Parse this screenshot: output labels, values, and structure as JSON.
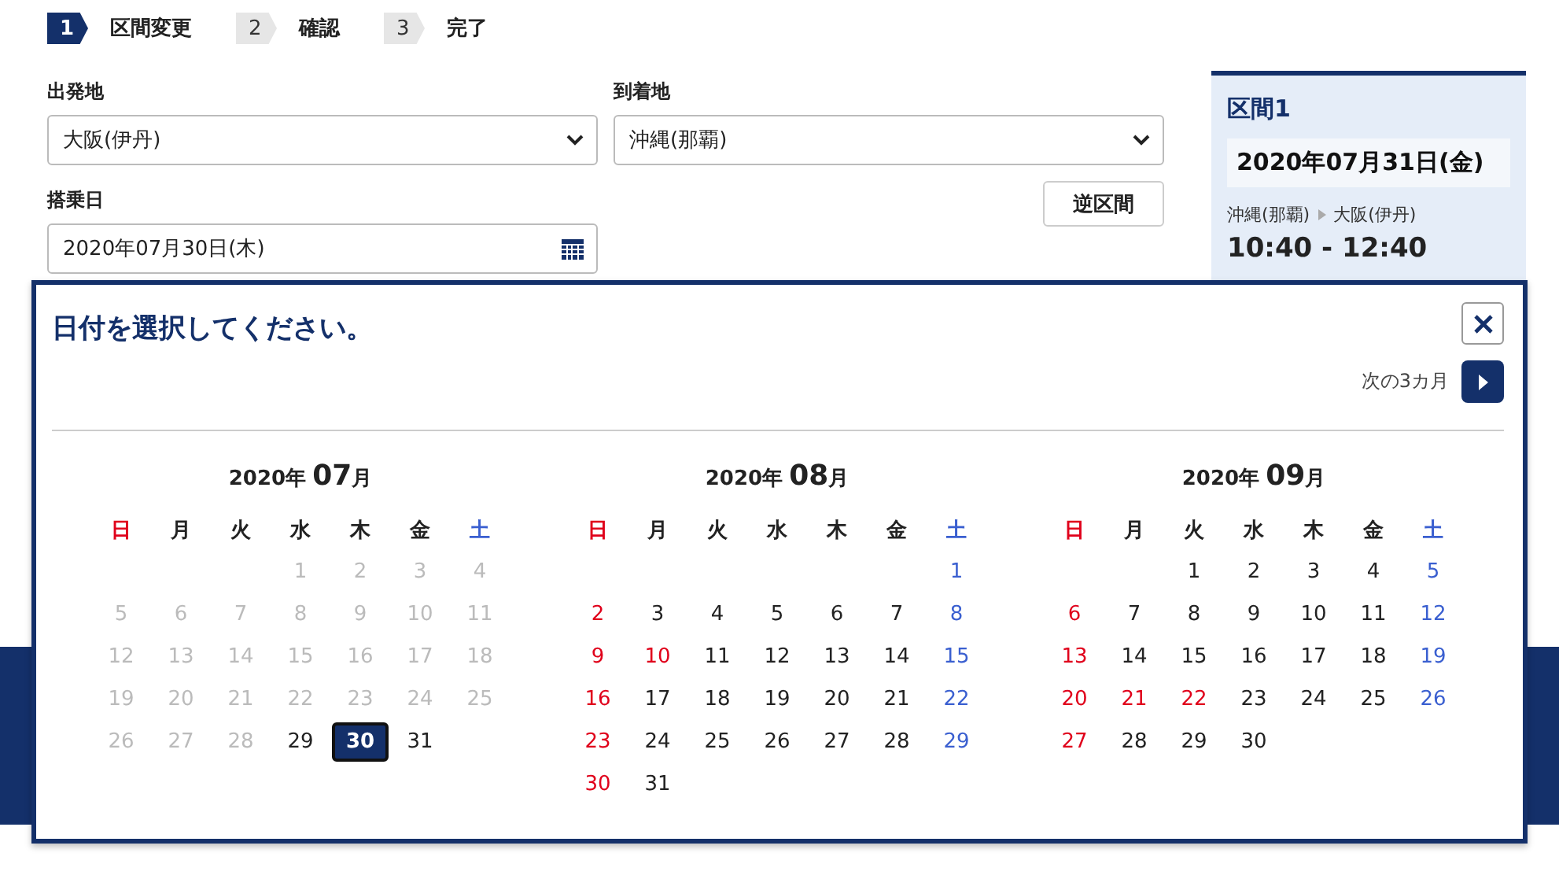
{
  "steps": [
    {
      "number": "1",
      "label": "区間変更",
      "selected": true
    },
    {
      "number": "2",
      "label": "確認",
      "selected": false
    },
    {
      "number": "3",
      "label": "完了",
      "selected": false
    }
  ],
  "form": {
    "departure": {
      "label": "出発地",
      "value": "大阪(伊丹)"
    },
    "arrival": {
      "label": "到着地",
      "value": "沖縄(那覇)"
    },
    "reverse_button": "逆区間",
    "date": {
      "label": "搭乗日",
      "value": "2020年07月30日(木)"
    }
  },
  "segment": {
    "title": "区間1",
    "date": "2020年07月31日(金)",
    "from": "沖縄(那覇)",
    "to": "大阪(伊丹)",
    "time": "10:40 - 12:40"
  },
  "datepicker": {
    "title": "日付を選択してください。",
    "next_label": "次の3カ月",
    "months": [
      {
        "year": "2020年",
        "month": "07",
        "unit": "月",
        "weekdays": [
          {
            "label": "日",
            "kind": "sunday"
          },
          {
            "label": "月",
            "kind": "weekday"
          },
          {
            "label": "火",
            "kind": "weekday"
          },
          {
            "label": "水",
            "kind": "weekday"
          },
          {
            "label": "木",
            "kind": "weekday"
          },
          {
            "label": "金",
            "kind": "weekday"
          },
          {
            "label": "土",
            "kind": "saturday"
          }
        ],
        "weeks": [
          [
            {
              "day": "1",
              "kind": "past",
              "selected": false
            },
            {
              "day": "2",
              "kind": "past",
              "selected": false
            },
            {
              "day": "3",
              "kind": "past",
              "selected": false
            },
            {
              "day": "4",
              "kind": "past",
              "selected": false
            }
          ],
          [
            {
              "day": "5",
              "kind": "past",
              "selected": false
            },
            {
              "day": "6",
              "kind": "past",
              "selected": false
            },
            {
              "day": "7",
              "kind": "past",
              "selected": false
            },
            {
              "day": "8",
              "kind": "past",
              "selected": false
            },
            {
              "day": "9",
              "kind": "past",
              "selected": false
            },
            {
              "day": "10",
              "kind": "past",
              "selected": false
            },
            {
              "day": "11",
              "kind": "past",
              "selected": false
            }
          ],
          [
            {
              "day": "12",
              "kind": "past",
              "selected": false
            },
            {
              "day": "13",
              "kind": "past",
              "selected": false
            },
            {
              "day": "14",
              "kind": "past",
              "selected": false
            },
            {
              "day": "15",
              "kind": "past",
              "selected": false
            },
            {
              "day": "16",
              "kind": "past",
              "selected": false
            },
            {
              "day": "17",
              "kind": "past",
              "selected": false
            },
            {
              "day": "18",
              "kind": "past",
              "selected": false
            }
          ],
          [
            {
              "day": "19",
              "kind": "past",
              "selected": false
            },
            {
              "day": "20",
              "kind": "past",
              "selected": false
            },
            {
              "day": "21",
              "kind": "past",
              "selected": false
            },
            {
              "day": "22",
              "kind": "past",
              "selected": false
            },
            {
              "day": "23",
              "kind": "past",
              "selected": false
            },
            {
              "day": "24",
              "kind": "past",
              "selected": false
            },
            {
              "day": "25",
              "kind": "past",
              "selected": false
            }
          ],
          [
            {
              "day": "26",
              "kind": "past",
              "selected": false
            },
            {
              "day": "27",
              "kind": "past",
              "selected": false
            },
            {
              "day": "28",
              "kind": "past",
              "selected": false
            },
            {
              "day": "29",
              "kind": "normal",
              "selected": false
            },
            {
              "day": "30",
              "kind": "normal",
              "selected": true
            },
            {
              "day": "31",
              "kind": "normal",
              "selected": false
            }
          ]
        ]
      },
      {
        "year": "2020年",
        "month": "08",
        "unit": "月",
        "weekdays": [
          {
            "label": "日",
            "kind": "sunday"
          },
          {
            "label": "月",
            "kind": "weekday"
          },
          {
            "label": "火",
            "kind": "weekday"
          },
          {
            "label": "水",
            "kind": "weekday"
          },
          {
            "label": "木",
            "kind": "weekday"
          },
          {
            "label": "金",
            "kind": "weekday"
          },
          {
            "label": "土",
            "kind": "saturday"
          }
        ],
        "weeks": [
          [
            {
              "day": "1",
              "kind": "saturday",
              "selected": false
            }
          ],
          [
            {
              "day": "2",
              "kind": "holiday",
              "selected": false
            },
            {
              "day": "3",
              "kind": "normal",
              "selected": false
            },
            {
              "day": "4",
              "kind": "normal",
              "selected": false
            },
            {
              "day": "5",
              "kind": "normal",
              "selected": false
            },
            {
              "day": "6",
              "kind": "normal",
              "selected": false
            },
            {
              "day": "7",
              "kind": "normal",
              "selected": false
            },
            {
              "day": "8",
              "kind": "saturday",
              "selected": false
            }
          ],
          [
            {
              "day": "9",
              "kind": "holiday",
              "selected": false
            },
            {
              "day": "10",
              "kind": "holiday",
              "selected": false
            },
            {
              "day": "11",
              "kind": "normal",
              "selected": false
            },
            {
              "day": "12",
              "kind": "normal",
              "selected": false
            },
            {
              "day": "13",
              "kind": "normal",
              "selected": false
            },
            {
              "day": "14",
              "kind": "normal",
              "selected": false
            },
            {
              "day": "15",
              "kind": "saturday",
              "selected": false
            }
          ],
          [
            {
              "day": "16",
              "kind": "holiday",
              "selected": false
            },
            {
              "day": "17",
              "kind": "normal",
              "selected": false
            },
            {
              "day": "18",
              "kind": "normal",
              "selected": false
            },
            {
              "day": "19",
              "kind": "normal",
              "selected": false
            },
            {
              "day": "20",
              "kind": "normal",
              "selected": false
            },
            {
              "day": "21",
              "kind": "normal",
              "selected": false
            },
            {
              "day": "22",
              "kind": "saturday",
              "selected": false
            }
          ],
          [
            {
              "day": "23",
              "kind": "holiday",
              "selected": false
            },
            {
              "day": "24",
              "kind": "normal",
              "selected": false
            },
            {
              "day": "25",
              "kind": "normal",
              "selected": false
            },
            {
              "day": "26",
              "kind": "normal",
              "selected": false
            },
            {
              "day": "27",
              "kind": "normal",
              "selected": false
            },
            {
              "day": "28",
              "kind": "normal",
              "selected": false
            },
            {
              "day": "29",
              "kind": "saturday",
              "selected": false
            }
          ],
          [
            {
              "day": "30",
              "kind": "holiday",
              "selected": false
            },
            {
              "day": "31",
              "kind": "normal",
              "selected": false
            }
          ]
        ]
      },
      {
        "year": "2020年",
        "month": "09",
        "unit": "月",
        "weekdays": [
          {
            "label": "日",
            "kind": "sunday"
          },
          {
            "label": "月",
            "kind": "weekday"
          },
          {
            "label": "火",
            "kind": "weekday"
          },
          {
            "label": "水",
            "kind": "weekday"
          },
          {
            "label": "木",
            "kind": "weekday"
          },
          {
            "label": "金",
            "kind": "weekday"
          },
          {
            "label": "土",
            "kind": "saturday"
          }
        ],
        "weeks": [
          [
            {
              "day": "1",
              "kind": "normal",
              "selected": false
            },
            {
              "day": "2",
              "kind": "normal",
              "selected": false
            },
            {
              "day": "3",
              "kind": "normal",
              "selected": false
            },
            {
              "day": "4",
              "kind": "normal",
              "selected": false
            },
            {
              "day": "5",
              "kind": "saturday",
              "selected": false
            }
          ],
          [
            {
              "day": "6",
              "kind": "holiday",
              "selected": false
            },
            {
              "day": "7",
              "kind": "normal",
              "selected": false
            },
            {
              "day": "8",
              "kind": "normal",
              "selected": false
            },
            {
              "day": "9",
              "kind": "normal",
              "selected": false
            },
            {
              "day": "10",
              "kind": "normal",
              "selected": false
            },
            {
              "day": "11",
              "kind": "normal",
              "selected": false
            },
            {
              "day": "12",
              "kind": "saturday",
              "selected": false
            }
          ],
          [
            {
              "day": "13",
              "kind": "holiday",
              "selected": false
            },
            {
              "day": "14",
              "kind": "normal",
              "selected": false
            },
            {
              "day": "15",
              "kind": "normal",
              "selected": false
            },
            {
              "day": "16",
              "kind": "normal",
              "selected": false
            },
            {
              "day": "17",
              "kind": "normal",
              "selected": false
            },
            {
              "day": "18",
              "kind": "normal",
              "selected": false
            },
            {
              "day": "19",
              "kind": "saturday",
              "selected": false
            }
          ],
          [
            {
              "day": "20",
              "kind": "holiday",
              "selected": false
            },
            {
              "day": "21",
              "kind": "holiday",
              "selected": false
            },
            {
              "day": "22",
              "kind": "holiday",
              "selected": false
            },
            {
              "day": "23",
              "kind": "normal",
              "selected": false
            },
            {
              "day": "24",
              "kind": "normal",
              "selected": false
            },
            {
              "day": "25",
              "kind": "normal",
              "selected": false
            },
            {
              "day": "26",
              "kind": "saturday",
              "selected": false
            }
          ],
          [
            {
              "day": "27",
              "kind": "holiday",
              "selected": false
            },
            {
              "day": "28",
              "kind": "normal",
              "selected": false
            },
            {
              "day": "29",
              "kind": "normal",
              "selected": false
            },
            {
              "day": "30",
              "kind": "normal",
              "selected": false
            }
          ]
        ]
      }
    ]
  }
}
